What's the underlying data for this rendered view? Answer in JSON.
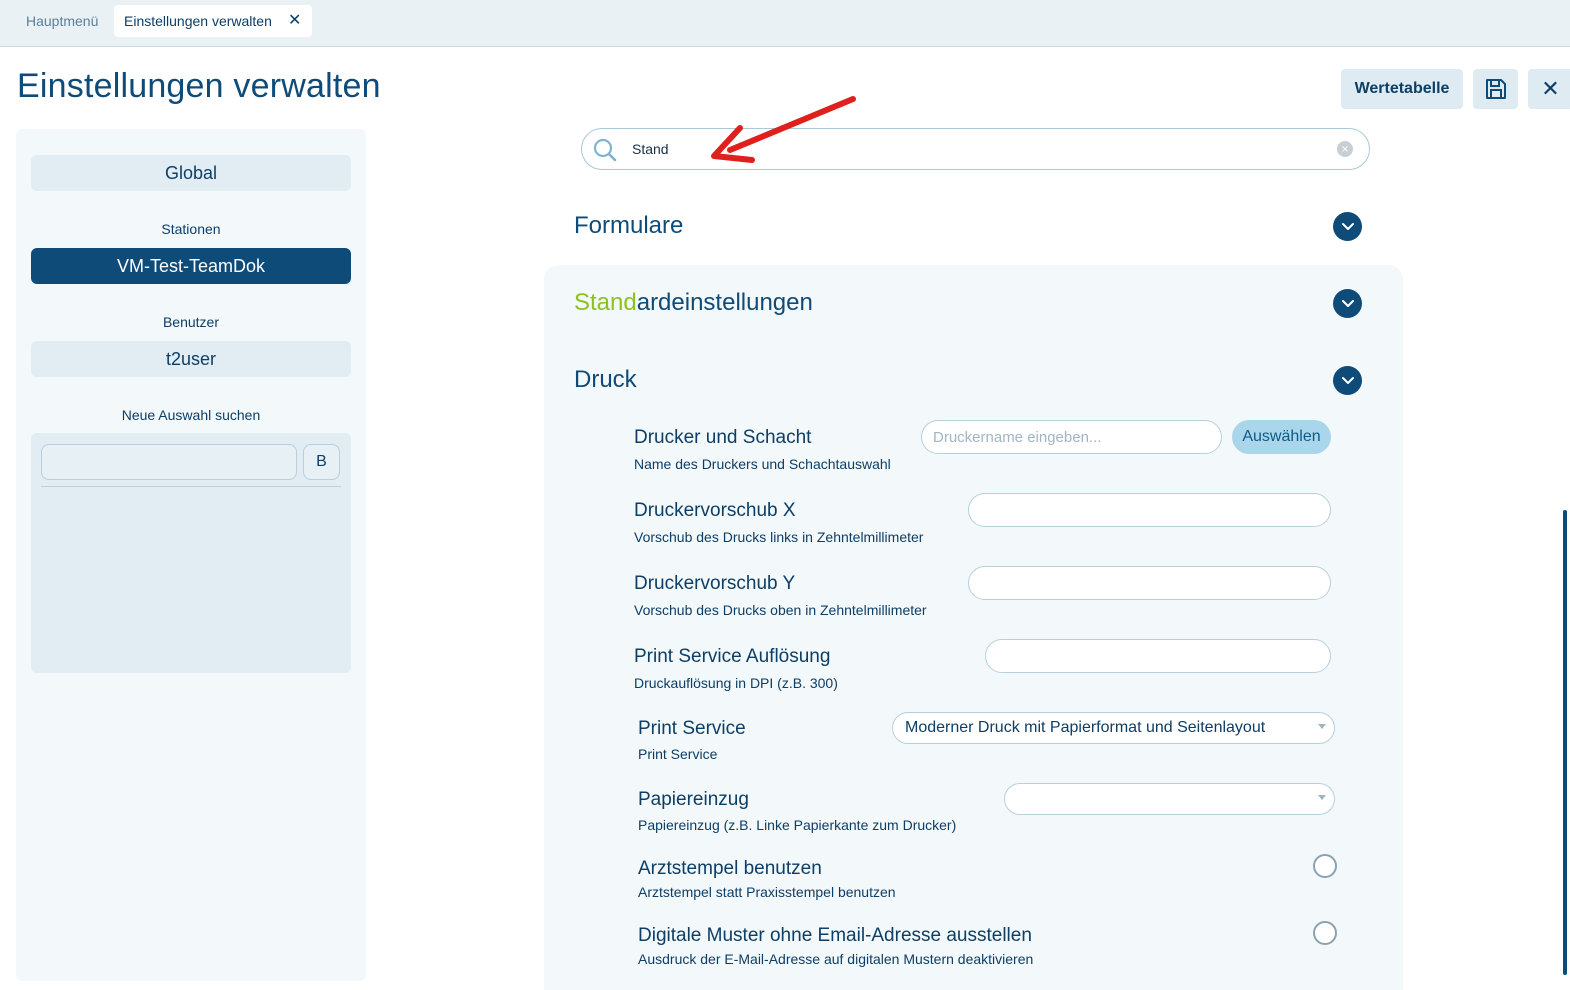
{
  "tabs": {
    "home": "Hauptmenü",
    "active": "Einstellungen verwalten",
    "close_glyph": "✕"
  },
  "page": {
    "title": "Einstellungen verwalten"
  },
  "header_buttons": {
    "werte_label": "Wertetabelle",
    "save_icon": "save-icon",
    "close_glyph": "✕"
  },
  "sidebar": {
    "global_label": "Global",
    "stations_heading": "Stationen",
    "station_selected": "VM-Test-TeamDok",
    "users_heading": "Benutzer",
    "user": "t2user",
    "new_search_heading": "Neue Auswahl suchen",
    "new_search_value": "",
    "b_button": "B"
  },
  "search": {
    "value": "Stand",
    "clear_glyph": "×"
  },
  "sections": {
    "formulare": "Formulare",
    "standard_highlight": "Stand",
    "standard_rest": "ardeinstellungen",
    "druck": "Druck"
  },
  "settings": [
    {
      "title": "Drucker und Schacht",
      "subtitle": "Name des Druckers und Schachtauswahl",
      "placeholder": "Druckername eingeben...",
      "button": "Auswählen"
    },
    {
      "title": "Druckervorschub X",
      "subtitle": "Vorschub des Drucks links in Zehntelmillimeter",
      "value": ""
    },
    {
      "title": "Druckervorschub Y",
      "subtitle": "Vorschub des Drucks oben in Zehntelmillimeter",
      "value": ""
    },
    {
      "title": "Print Service Auflösung",
      "subtitle": "Druckauflösung in DPI (z.B. 300)",
      "value": ""
    },
    {
      "title": "Print Service",
      "subtitle": "Print Service",
      "selected": "Moderner Druck mit Papierformat und Seitenlayout"
    },
    {
      "title": "Papiereinzug",
      "subtitle": "Papiereinzug (z.B. Linke Papierkante zum Drucker)",
      "selected": ""
    },
    {
      "title": "Arztstempel benutzen",
      "subtitle": "Arztstempel statt Praxisstempel benutzen",
      "checked": false
    },
    {
      "title": "Digitale Muster ohne Email-Adresse ausstellen",
      "subtitle": "Ausdruck der E-Mail-Adresse auf digitalen Mustern deaktivieren",
      "checked": false
    }
  ],
  "colors": {
    "primary": "#0e4b78",
    "highlight": "#8cc21f",
    "arrow": "#e0201c",
    "pick_button": "#a9d6ea"
  }
}
